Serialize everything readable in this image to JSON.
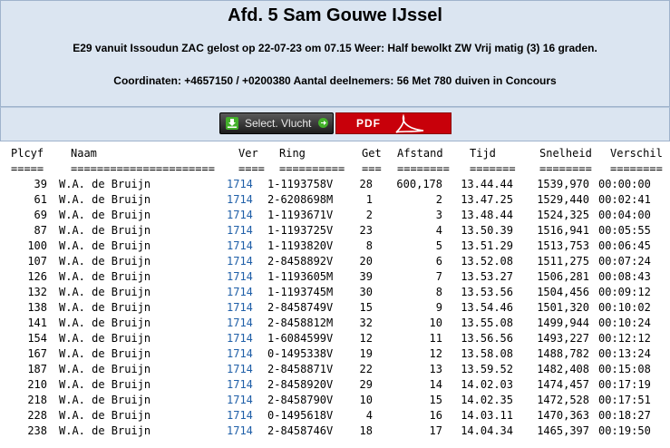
{
  "header": {
    "title": "Afd. 5 Sam Gouwe IJssel",
    "line1": "E29 vanuit Issoudun ZAC gelost op 22-07-23 om 07.15 Weer: Half bewolkt ZW Vrij matig (3) 16 graden.",
    "line2": "Coordinaten: +4657150 / +0200380 Aantal deelnemers: 56 Met 780 duiven in Concours"
  },
  "toolbar": {
    "select_label": "Select. Vlucht",
    "pdf_label": "PDF"
  },
  "table": {
    "columns": [
      "Plcyf",
      "Naam",
      "Ver",
      "Ring",
      "Get",
      "Afstand",
      "Tijd",
      "Snelheid",
      "Verschil"
    ],
    "underlines": [
      "=====",
      "======================",
      "====",
      "==========",
      "===",
      "========",
      "=======",
      "========",
      "========"
    ],
    "rows": [
      {
        "plcyf": "39",
        "naam": "W.A. de Bruijn",
        "ver": "1714",
        "ring": "1-1193758V",
        "get": "28",
        "afstand": "600,178",
        "tijd": "13.44.44",
        "snelheid": "1539,970",
        "verschil": "00:00:00"
      },
      {
        "plcyf": "61",
        "naam": "W.A. de Bruijn",
        "ver": "1714",
        "ring": "2-6208698M",
        "get": "1",
        "afstand": "2",
        "tijd": "13.47.25",
        "snelheid": "1529,440",
        "verschil": "00:02:41"
      },
      {
        "plcyf": "69",
        "naam": "W.A. de Bruijn",
        "ver": "1714",
        "ring": "1-1193671V",
        "get": "2",
        "afstand": "3",
        "tijd": "13.48.44",
        "snelheid": "1524,325",
        "verschil": "00:04:00"
      },
      {
        "plcyf": "87",
        "naam": "W.A. de Bruijn",
        "ver": "1714",
        "ring": "1-1193725V",
        "get": "23",
        "afstand": "4",
        "tijd": "13.50.39",
        "snelheid": "1516,941",
        "verschil": "00:05:55"
      },
      {
        "plcyf": "100",
        "naam": "W.A. de Bruijn",
        "ver": "1714",
        "ring": "1-1193820V",
        "get": "8",
        "afstand": "5",
        "tijd": "13.51.29",
        "snelheid": "1513,753",
        "verschil": "00:06:45"
      },
      {
        "plcyf": "107",
        "naam": "W.A. de Bruijn",
        "ver": "1714",
        "ring": "2-8458892V",
        "get": "20",
        "afstand": "6",
        "tijd": "13.52.08",
        "snelheid": "1511,275",
        "verschil": "00:07:24"
      },
      {
        "plcyf": "126",
        "naam": "W.A. de Bruijn",
        "ver": "1714",
        "ring": "1-1193605M",
        "get": "39",
        "afstand": "7",
        "tijd": "13.53.27",
        "snelheid": "1506,281",
        "verschil": "00:08:43"
      },
      {
        "plcyf": "132",
        "naam": "W.A. de Bruijn",
        "ver": "1714",
        "ring": "1-1193745M",
        "get": "30",
        "afstand": "8",
        "tijd": "13.53.56",
        "snelheid": "1504,456",
        "verschil": "00:09:12"
      },
      {
        "plcyf": "138",
        "naam": "W.A. de Bruijn",
        "ver": "1714",
        "ring": "2-8458749V",
        "get": "15",
        "afstand": "9",
        "tijd": "13.54.46",
        "snelheid": "1501,320",
        "verschil": "00:10:02"
      },
      {
        "plcyf": "141",
        "naam": "W.A. de Bruijn",
        "ver": "1714",
        "ring": "2-8458812M",
        "get": "32",
        "afstand": "10",
        "tijd": "13.55.08",
        "snelheid": "1499,944",
        "verschil": "00:10:24"
      },
      {
        "plcyf": "154",
        "naam": "W.A. de Bruijn",
        "ver": "1714",
        "ring": "1-6084599V",
        "get": "12",
        "afstand": "11",
        "tijd": "13.56.56",
        "snelheid": "1493,227",
        "verschil": "00:12:12"
      },
      {
        "plcyf": "167",
        "naam": "W.A. de Bruijn",
        "ver": "1714",
        "ring": "0-1495338V",
        "get": "19",
        "afstand": "12",
        "tijd": "13.58.08",
        "snelheid": "1488,782",
        "verschil": "00:13:24"
      },
      {
        "plcyf": "187",
        "naam": "W.A. de Bruijn",
        "ver": "1714",
        "ring": "2-8458871V",
        "get": "22",
        "afstand": "13",
        "tijd": "13.59.52",
        "snelheid": "1482,408",
        "verschil": "00:15:08"
      },
      {
        "plcyf": "210",
        "naam": "W.A. de Bruijn",
        "ver": "1714",
        "ring": "2-8458920V",
        "get": "29",
        "afstand": "14",
        "tijd": "14.02.03",
        "snelheid": "1474,457",
        "verschil": "00:17:19"
      },
      {
        "plcyf": "218",
        "naam": "W.A. de Bruijn",
        "ver": "1714",
        "ring": "2-8458790V",
        "get": "10",
        "afstand": "15",
        "tijd": "14.02.35",
        "snelheid": "1472,528",
        "verschil": "00:17:51"
      },
      {
        "plcyf": "228",
        "naam": "W.A. de Bruijn",
        "ver": "1714",
        "ring": "0-1495618V",
        "get": "4",
        "afstand": "16",
        "tijd": "14.03.11",
        "snelheid": "1470,363",
        "verschil": "00:18:27"
      },
      {
        "plcyf": "238",
        "naam": "W.A. de Bruijn",
        "ver": "1714",
        "ring": "2-8458746V",
        "get": "18",
        "afstand": "17",
        "tijd": "14.04.34",
        "snelheid": "1465,397",
        "verschil": "00:19:50"
      }
    ]
  },
  "colors": {
    "header_bg": "#dbe5f1",
    "link": "#1f5fa8",
    "pdf_bg": "#c8000a"
  }
}
